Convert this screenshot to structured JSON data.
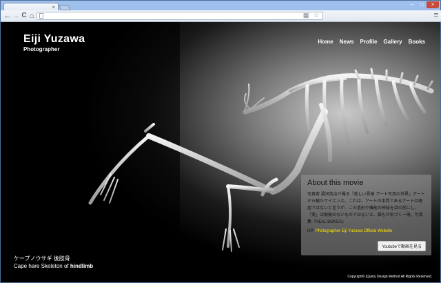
{
  "browser": {
    "tab_close": "×",
    "window_controls": [
      "–",
      "□",
      "×"
    ],
    "nav_icons": [
      "back-icon",
      "forward-icon",
      "reload-icon",
      "home-icon"
    ],
    "nav_glyphs": [
      "←",
      "→",
      "C",
      "⌂"
    ],
    "menu_glyph": "≡",
    "omnibox_glyphs": "▦ ☆"
  },
  "site": {
    "brand_name": "Eiji Yuzawa",
    "brand_sub": "Photographer",
    "nav": [
      "Home",
      "News",
      "Profile",
      "Gallery",
      "Books"
    ]
  },
  "about": {
    "title": "About this movie",
    "body": "写真家 湯沢英治が撮る『美しい骨格 アート写真の世界』アートから観たサイエンス。これは、アートの本質であるアートは理屈ではないと言うが、この造形や機能の神秘を目の前にし、「美」は根拠のないものではないと、誰もが気づく一冊。写真集「REAL BONES」",
    "link_prefix": "HP:",
    "link_text": "Photographer Eiji Yuzawa Official Website",
    "button": "Youtubeで動画を見る"
  },
  "caption": {
    "jp": "ケープノウサギ 後肢骨",
    "en_prefix": "Cape hare Skeleton of ",
    "en_bold": "hindlimb"
  },
  "footer": {
    "copyright": "Copyright© jQuery Design Method All Rights Reserved."
  },
  "colors": {
    "link": "#ffe400",
    "page_bg": "#000000",
    "chrome_frame": "#7ea3d6"
  }
}
